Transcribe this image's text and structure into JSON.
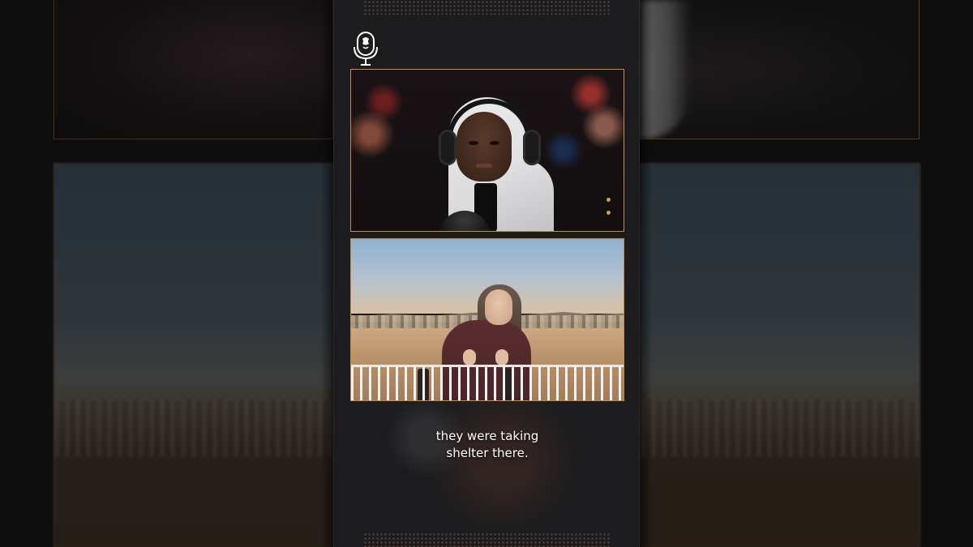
{
  "caption": {
    "line1": "they were taking",
    "line2": "shelter there."
  },
  "icons": {
    "logo": "podcast-microphone-logo-icon"
  },
  "colors": {
    "frame_border": "#c98a3a",
    "column_bg": "#1c1c1e",
    "page_bg": "#0d0d0e",
    "caption_text": "#ffffff"
  }
}
